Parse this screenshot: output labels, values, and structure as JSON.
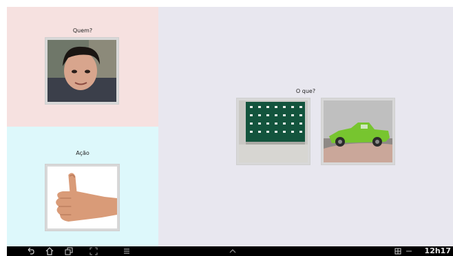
{
  "panels": {
    "who": {
      "label": "Quem?"
    },
    "action": {
      "label": "Ação"
    },
    "what": {
      "label": "O que?"
    }
  },
  "cards": {
    "who": {
      "subject": "boy-photo"
    },
    "action": {
      "subject": "thumbs-up-photo"
    },
    "what": [
      {
        "subject": "green-board-photo"
      },
      {
        "subject": "green-toy-car-photo"
      }
    ]
  },
  "status_bar": {
    "time": "12h17"
  },
  "colors": {
    "who_bg": "#f6e1e0",
    "action_bg": "#ddf8fb",
    "what_bg": "#e8e7ef",
    "navbar_bg": "#000000"
  },
  "icons": [
    "back-icon",
    "home-icon",
    "recent-apps-icon",
    "screenshot-icon",
    "menu-icon",
    "up-chevron-icon",
    "gallery-icon",
    "minus-icon"
  ]
}
